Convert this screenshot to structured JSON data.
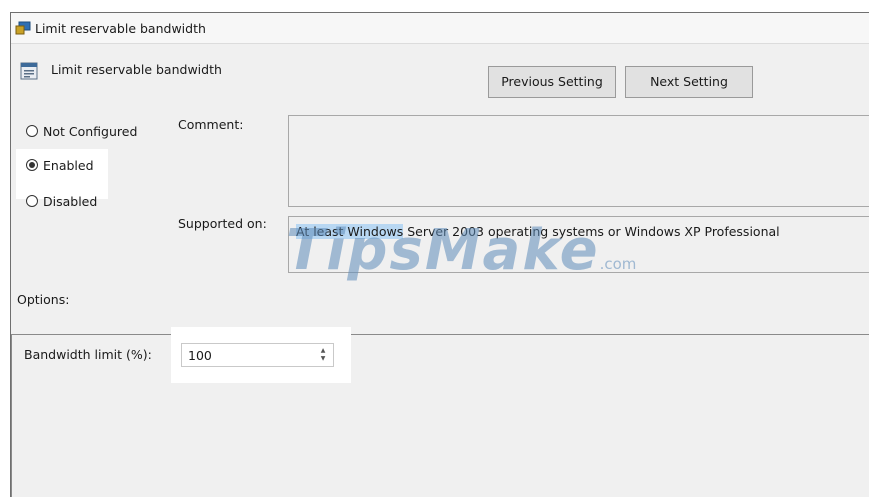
{
  "window": {
    "title": "Limit reservable bandwidth"
  },
  "header": {
    "setting_name": "Limit reservable bandwidth",
    "previous_button": "Previous Setting",
    "next_button": "Next Setting"
  },
  "state": {
    "options": [
      {
        "label": "Not Configured",
        "checked": false
      },
      {
        "label": "Enabled",
        "checked": true
      },
      {
        "label": "Disabled",
        "checked": false
      }
    ]
  },
  "comment": {
    "label": "Comment:",
    "value": ""
  },
  "supported": {
    "label": "Supported on:",
    "text_selected": "At least Windows",
    "text_rest": " Server 2003 operating systems or Windows XP Professional"
  },
  "options_panel": {
    "label": "Options:",
    "bandwidth_label": "Bandwidth limit (%):",
    "bandwidth_value": "100"
  },
  "watermark": {
    "main": "TipsMake",
    "suffix": ".com"
  },
  "icons": {
    "title": "policy-setting-icon",
    "setting": "policy-document-icon",
    "spin_up": "spin-up-icon",
    "spin_down": "spin-down-icon"
  }
}
